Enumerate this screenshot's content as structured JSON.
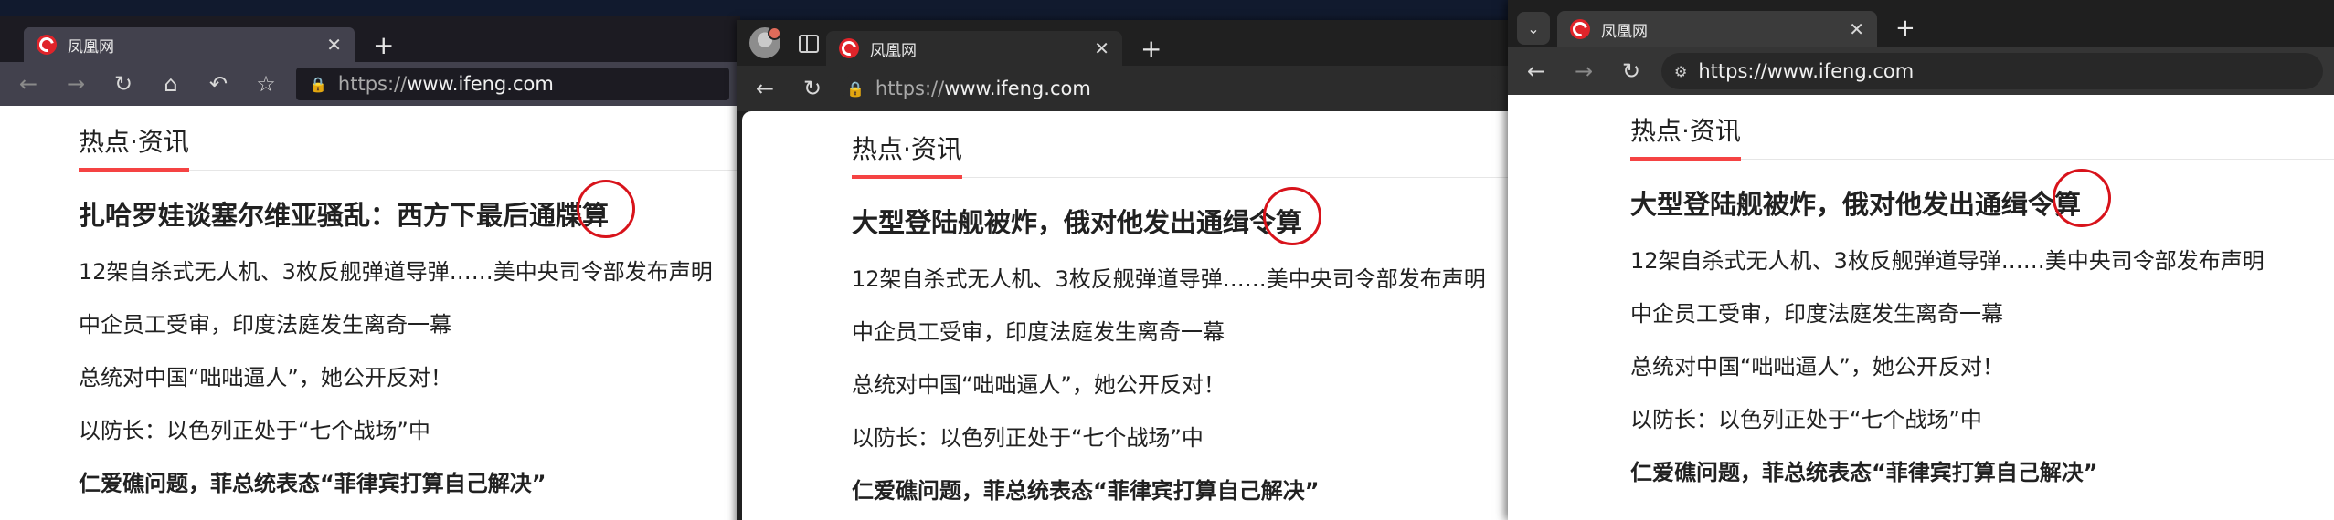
{
  "windows": [
    {
      "browser": "Firefox",
      "tab_title": "凤凰网",
      "url_protocol": "https://",
      "url_host": "www.ifeng.com",
      "headline": "扎哈罗娃谈塞尔维亚骚乱：西方下最后通牒算",
      "items": [
        "12架自杀式无人机、3枚反舰弹道导弹……美中央司令部发布声明",
        "中企员工受审，印度法庭发生离奇一幕",
        "总统对中国“咄咄逼人”，她公开反对！",
        "以防长：以色列正处于“七个战场”中",
        "仁爱礁问题，菲总统表态“菲律宾打算自己解决”"
      ]
    },
    {
      "browser": "Edge",
      "tab_title": "凤凰网",
      "url_protocol": "https://",
      "url_host": "www.ifeng.com",
      "headline": "大型登陆舰被炸，俄对他发出通缉令算",
      "items": [
        "12架自杀式无人机、3枚反舰弹道导弹……美中央司令部发布声明",
        "中企员工受审，印度法庭发生离奇一幕",
        "总统对中国“咄咄逼人”，她公开反对！",
        "以防长：以色列正处于“七个战场”中",
        "仁爱礁问题，菲总统表态“菲律宾打算自己解决”"
      ]
    },
    {
      "browser": "Chrome",
      "tab_title": "凤凰网",
      "url": "https://www.ifeng.com",
      "headline": "大型登陆舰被炸，俄对他发出通缉令算",
      "items": [
        "12架自杀式无人机、3枚反舰弹道导弹……美中央司令部发布声明",
        "中企员工受审，印度法庭发生离奇一幕",
        "总统对中国“咄咄逼人”，她公开反对！",
        "以防长：以色列正处于“七个战场”中",
        "仁爱礁问题，菲总统表态“菲律宾打算自己解决”"
      ]
    }
  ],
  "section_title": "热点·资讯",
  "icons": {
    "close": "✕",
    "new_tab": "+",
    "back": "←",
    "forward": "→",
    "reload": "↻",
    "home": "⌂",
    "undo": "↶",
    "bookmark": "☆",
    "lock": "🔒",
    "dropdown": "⌄",
    "site_info": "⚙"
  },
  "colors": {
    "accent_red": "#f54343",
    "circle_red": "#d8131b",
    "brand_red": "#e0242a"
  }
}
